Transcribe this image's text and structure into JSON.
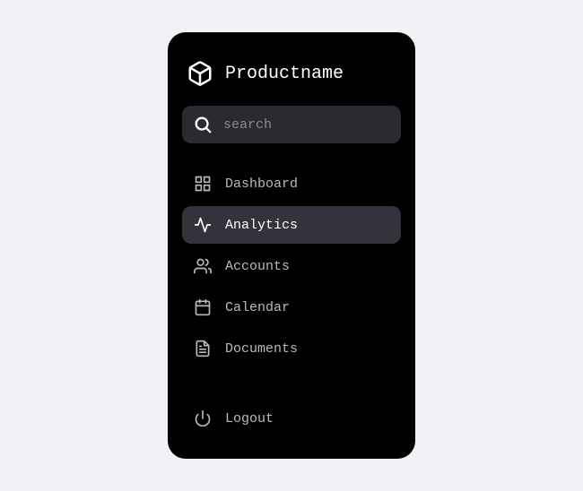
{
  "brand": {
    "title": "Productname",
    "icon": "box-icon"
  },
  "search": {
    "placeholder": "search",
    "value": ""
  },
  "nav": {
    "items": [
      {
        "label": "Dashboard",
        "icon": "grid-icon",
        "active": false
      },
      {
        "label": "Analytics",
        "icon": "activity-icon",
        "active": true
      },
      {
        "label": "Accounts",
        "icon": "users-icon",
        "active": false
      },
      {
        "label": "Calendar",
        "icon": "calendar-icon",
        "active": false
      },
      {
        "label": "Documents",
        "icon": "file-text-icon",
        "active": false
      }
    ]
  },
  "footer": {
    "logout_label": "Logout"
  },
  "colors": {
    "bg": "#f2f2f6",
    "panel": "#000000",
    "item_active_bg": "#33343b",
    "search_bg": "#2a2b30",
    "text": "#ffffff",
    "text_muted": "#b9bac0"
  }
}
